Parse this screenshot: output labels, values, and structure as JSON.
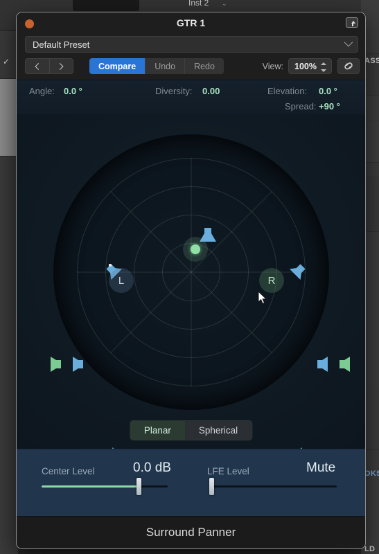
{
  "background": {
    "inst_label": "Inst 2",
    "chevron": "⌄",
    "right_labels": [
      "ASS",
      "OKS",
      "LD"
    ],
    "check_mark": "✓"
  },
  "window": {
    "title": "GTR 1",
    "close_icon": "close-button",
    "expand_icon": "expand-button"
  },
  "preset": {
    "name": "Default Preset",
    "chevron_icon": "chevron-down-icon"
  },
  "toolbar": {
    "prev_label": "",
    "next_label": "",
    "compare_label": "Compare",
    "undo_label": "Undo",
    "redo_label": "Redo",
    "view_label": "View:",
    "view_value": "100%",
    "link_icon": "link-icon"
  },
  "params": {
    "angle_label": "Angle:",
    "angle_value": "0.0 °",
    "diversity_label": "Diversity:",
    "diversity_value": "0.00",
    "elevation_label": "Elevation:",
    "elevation_value": "0.0 °",
    "spread_label": "Spread:",
    "spread_value": "+90 °"
  },
  "panner": {
    "puck_left_label": "L",
    "puck_right_label": "R",
    "center_puck_name": "center-source-puck",
    "speakers": [
      {
        "name": "speaker-top-center",
        "color": "#6aaede",
        "angle": 0
      },
      {
        "name": "speaker-front-left",
        "color": "#6aaede",
        "angle": -45
      },
      {
        "name": "speaker-front-right",
        "color": "#6aaede",
        "angle": 45
      },
      {
        "name": "speaker-side-left-inner",
        "color": "#6aaede",
        "angle": -90
      },
      {
        "name": "speaker-side-left-outer",
        "color": "#7ccb93",
        "angle": -90
      },
      {
        "name": "speaker-side-right-inner",
        "color": "#6aaede",
        "angle": 90
      },
      {
        "name": "speaker-side-right-outer",
        "color": "#7ccb93",
        "angle": 90
      },
      {
        "name": "speaker-rear-left",
        "color": "#6aaede",
        "angle": -135
      },
      {
        "name": "speaker-rear-right",
        "color": "#6aaede",
        "angle": 135
      }
    ],
    "ring_count": 4,
    "accent_green": "#8ee0a4",
    "accent_blue": "#6aaede"
  },
  "mode": {
    "planar_label": "Planar",
    "spherical_label": "Spherical",
    "selected": "Planar"
  },
  "levels": {
    "center_label": "Center Level",
    "center_value": "0.0 dB",
    "center_percent": 78,
    "lfe_label": "LFE Level",
    "lfe_value": "Mute",
    "lfe_percent": 0
  },
  "footer": {
    "plugin_name": "Surround Panner"
  }
}
